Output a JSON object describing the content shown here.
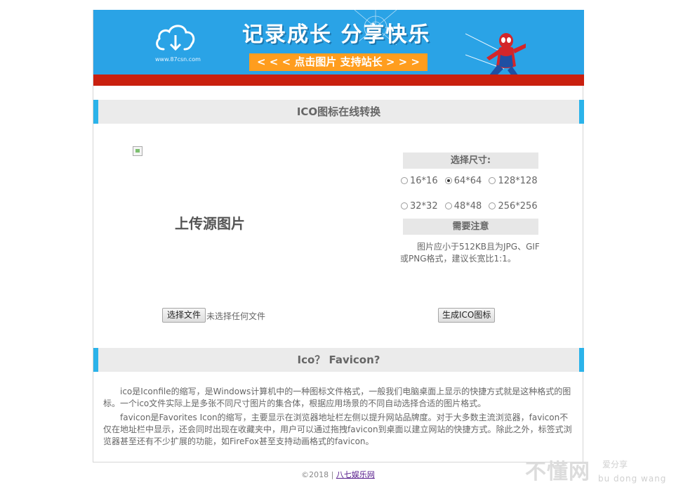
{
  "banner": {
    "site_text": "www.87csn.com",
    "slogan": "记录成长 分享快乐",
    "cta_label": "< < <  点击图片  支持站长  > > >",
    "colors": {
      "background": "#2aa3e6",
      "stripe": "#c9200f",
      "cta": "#ff9d1e"
    }
  },
  "converter": {
    "title": "ICO图标在线转换",
    "upload_label": "上传源图片",
    "file_button": "选择文件",
    "file_status": "未选择任何文件",
    "size_heading": "选择尺寸:",
    "sizes": [
      {
        "label": "16*16",
        "selected": false
      },
      {
        "label": "64*64",
        "selected": true
      },
      {
        "label": "128*128",
        "selected": false
      },
      {
        "label": "32*32",
        "selected": false
      },
      {
        "label": "48*48",
        "selected": false
      },
      {
        "label": "256*256",
        "selected": false
      }
    ],
    "notice_heading": "需要注意",
    "notice_text": "图片应小于512KB且为JPG、GIF或PNG格式，建议长宽比1:1。",
    "generate_button": "生成ICO图标"
  },
  "about": {
    "title": "Ico？ Favicon?",
    "paragraph1": "ico是Iconfile的缩写，是Windows计算机中的一种图标文件格式，一般我们电脑桌面上显示的快捷方式就是这种格式的图标。一个ico文件实际上是多张不同尺寸图片的集合体，根据应用场景的不同自动选择合适的图片格式。",
    "paragraph2": "favicon是Favorites Icon的缩写，主要显示在浏览器地址栏左侧以提升网站品牌度。对于大多数主流浏览器，favicon不仅在地址栏中显示，还会同时出现在收藏夹中，用户可以通过拖拽favicon到桌面以建立网站的快捷方式。除此之外，标签式浏览器甚至还有不少扩展的功能，如FireFox甚至支持动画格式的favicon。"
  },
  "footer": {
    "copyright": "©2018 | ",
    "link": "八七娱乐网"
  },
  "watermark": {
    "main": "不懂网",
    "tag": "爱分享",
    "pinyin": "bu dong wang"
  }
}
